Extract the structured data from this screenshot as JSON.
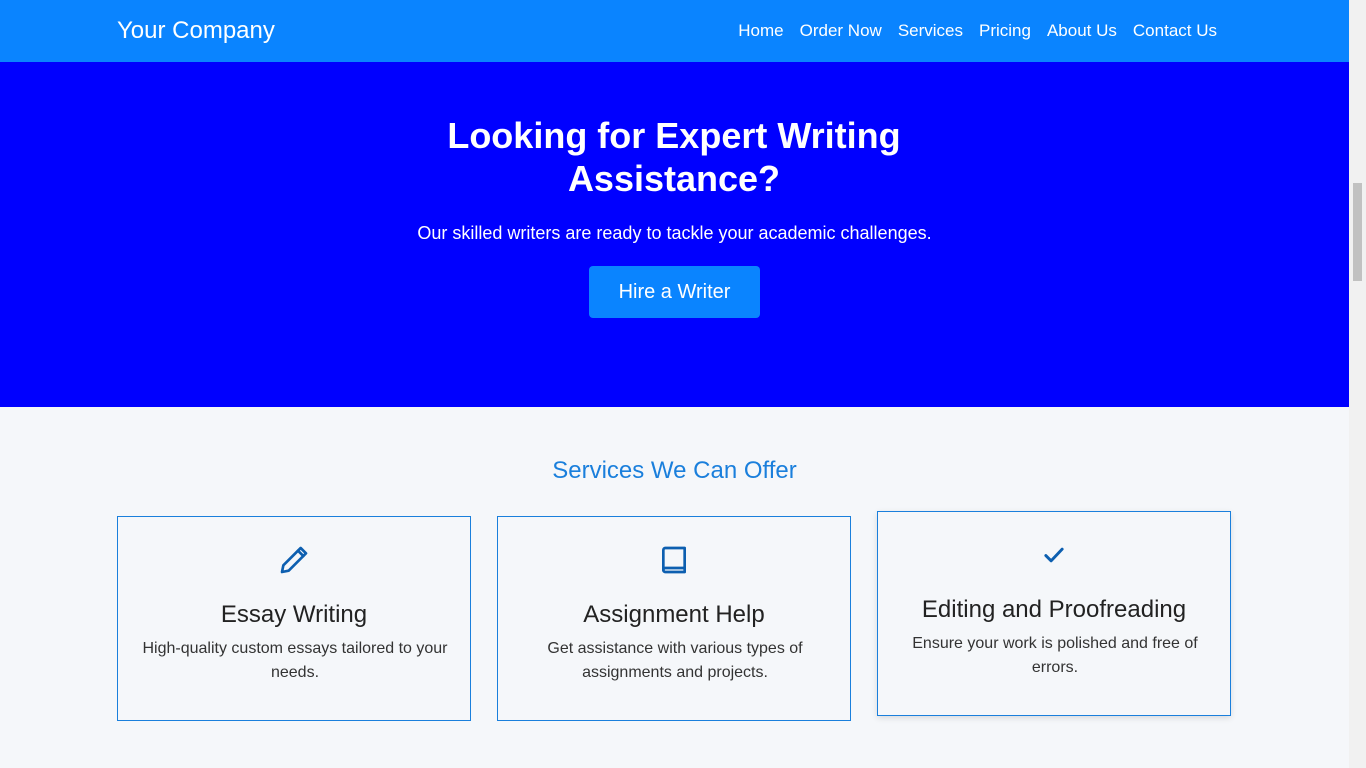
{
  "navbar": {
    "brand": "Your Company",
    "links": [
      {
        "label": "Home"
      },
      {
        "label": "Order Now"
      },
      {
        "label": "Services"
      },
      {
        "label": "Pricing"
      },
      {
        "label": "About Us"
      },
      {
        "label": "Contact Us"
      }
    ],
    "background_color": "#0a84ff"
  },
  "hero": {
    "title": "Looking for Expert Writing Assistance?",
    "subtitle": "Our skilled writers are ready to tackle your academic challenges.",
    "button_label": "Hire a Writer",
    "background_color": "#0000ff"
  },
  "services": {
    "heading": "Services We Can Offer",
    "accent_color": "#1a7fdc",
    "cards": [
      {
        "icon": "pencil-icon",
        "title": "Essay Writing",
        "description": "High-quality custom essays tailored to your needs."
      },
      {
        "icon": "book-icon",
        "title": "Assignment Help",
        "description": "Get assistance with various types of assignments and projects."
      },
      {
        "icon": "check-icon",
        "title": "Editing and Proofreading",
        "description": "Ensure your work is polished and free of errors."
      }
    ]
  }
}
